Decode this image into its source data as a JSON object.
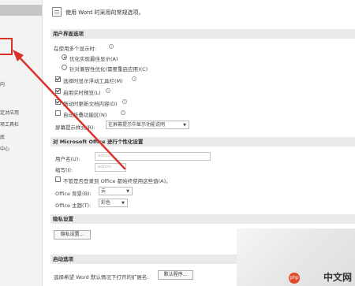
{
  "sidebar": {
    "items": [
      "向",
      "定对应用",
      "项工具栏",
      "底",
      "中心"
    ]
  },
  "header_tip": "使用 Word 时采用的常规选项。",
  "ui_section": {
    "title": "用户界面选项",
    "multi_display_label": "在使用多个显示时:",
    "radio_1": "优化实现最佳显示(A)",
    "radio_2": "针对兼容性优化(需要重启应用)(C)",
    "check_1": "选择时显示浮动工具栏(M)",
    "check_2": "启用实时预览(L)",
    "check_3": "拖动时更新文档内容(D)",
    "check_4": "自动折叠功能区(N)",
    "tip_style_label": "屏幕提示样式(R):",
    "tip_style_value": "在屏幕提示中显示功能说明"
  },
  "personal_section": {
    "title": "对 Microsoft Office 进行个性化设置",
    "username_label": "用户名(U):",
    "username_value": "admin",
    "initials_label": "缩写(I):",
    "initials_value": "admin",
    "always_use_label": "不管是否登录到 Office 都始终使用这些值(A)。",
    "background_label": "Office 背景(B):",
    "background_value": "云",
    "theme_label": "Office 主题(T):",
    "theme_value": "彩色"
  },
  "privacy_section": {
    "title": "隐私设置",
    "button": "隐私设置..."
  },
  "startup_section": {
    "title": "启动选项",
    "default_label": "选择希望 Word 默认情况下打开的扩展名:",
    "default_button": "默认程序..."
  },
  "watermark": {
    "logo": "php",
    "text": "中文网"
  },
  "colors": {
    "annotation_red": "#d9342b",
    "section_bg": "#eaeaea",
    "sidebar_bg": "#f3f3f3"
  }
}
